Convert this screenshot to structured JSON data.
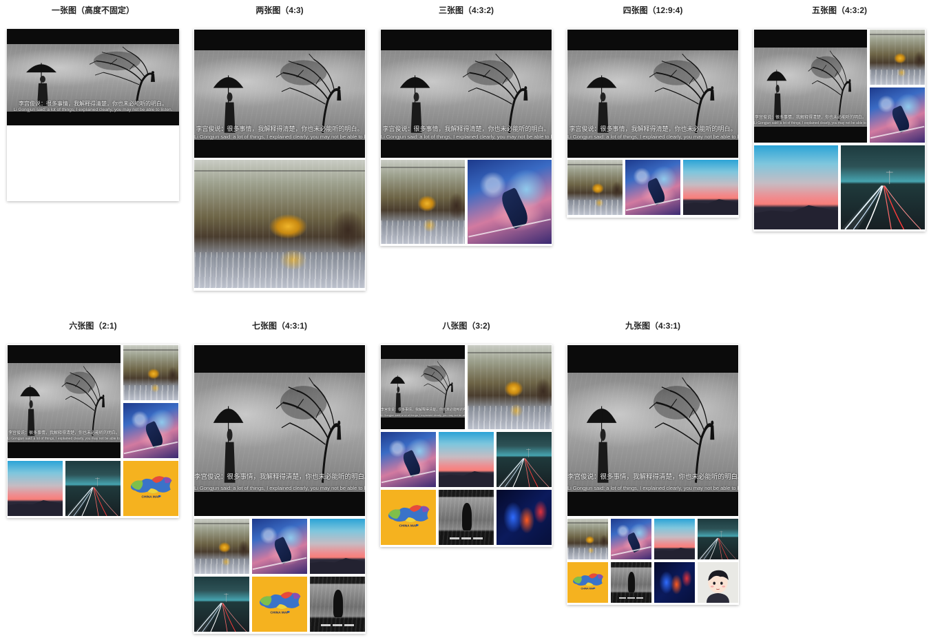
{
  "sections": [
    {
      "title": "一张图（高度不固定）"
    },
    {
      "title": "两张图（4:3)"
    },
    {
      "title": "三张图（4:3:2)"
    },
    {
      "title": "四张图（12:9:4)"
    },
    {
      "title": "五张图（4:3:2)"
    },
    {
      "title": "六张图（2:1)"
    },
    {
      "title": "七张图（4:3:1)"
    },
    {
      "title": "八张图（3:2)"
    },
    {
      "title": "九张图（4:3:1)"
    }
  ],
  "quote": {
    "cn": "李宫俊说：很多事情，我解释得清楚，你也未必能听的明白。",
    "en": "Li Gongjun said: a lot of things, I explained clearly, you may not be able to listen."
  },
  "map": {
    "label": "CHINA MAP"
  }
}
